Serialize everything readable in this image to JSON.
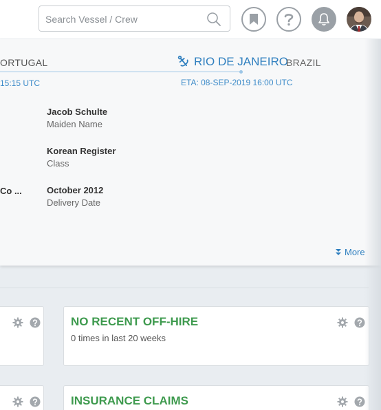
{
  "header": {
    "search_placeholder": "Search Vessel / Crew"
  },
  "voyage": {
    "origin_country": "ORTUGAL",
    "origin_time": "15:15 UTC",
    "destination_port": "RIO DE JANEIRO",
    "destination_country": "BRAZIL",
    "eta": "ETA: 08-SEP-2019 16:00 UTC"
  },
  "details": {
    "maiden_name": {
      "value": "Jacob Schulte",
      "label": "Maiden Name"
    },
    "class": {
      "value": "Korean Register",
      "label": "Class"
    },
    "delivery_date": {
      "value": "October 2012",
      "label": "Delivery Date"
    },
    "left_truncated": "Co ..."
  },
  "more_label": "More",
  "widgets": {
    "offhire": {
      "title": "NO RECENT OFF-HIRE",
      "subtitle": "0 times in last 20 weeks"
    },
    "insurance": {
      "title": "INSURANCE CLAIMS"
    }
  },
  "colors": {
    "accent_blue": "#2f7fbf",
    "accent_green": "#3e9a4e"
  }
}
